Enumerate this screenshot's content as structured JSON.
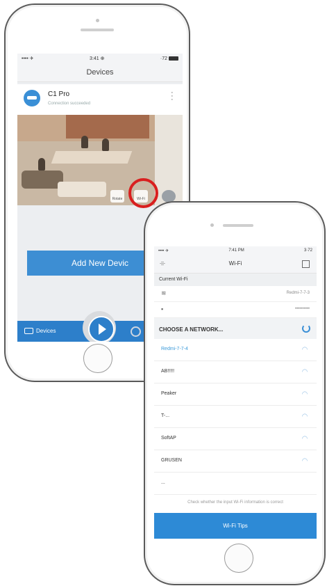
{
  "phone1": {
    "status": {
      "left": "•••• ✈",
      "center": "3:41 ⊕",
      "right": "·72"
    },
    "title": "Devices",
    "device": {
      "name": "C1 Pro",
      "status": "Connection succeeded"
    },
    "camera_controls": [
      "Rotate",
      "Wi-Fi"
    ],
    "add_button": "Add New Devic",
    "tabs": {
      "devices": "Devices",
      "settings": "S"
    }
  },
  "phone2": {
    "status": {
      "left": "•••• ✈",
      "center": "7:41 PM",
      "right": "3·72"
    },
    "title": "Wi-Fi",
    "current_section": "Current Wi-Fi",
    "current_network": "Redmi-7-7-3",
    "password_mask": "••••••••••",
    "choose_title": "CHOOSE A NETWORK...",
    "networks": [
      "Redmi-7-7-4",
      "AB!!!!!",
      "Peaker",
      "T-...",
      "SoftAP",
      "GRUSEN",
      "..."
    ],
    "hint": "Check whether the input Wi-Fi information is correct",
    "tips_button": "Wi-Fi Tips"
  },
  "icons": {
    "wifi": "wifi-icon",
    "lock": "lock-icon",
    "refresh": "refresh-icon",
    "play": "play-icon",
    "gear": "gear-icon"
  }
}
